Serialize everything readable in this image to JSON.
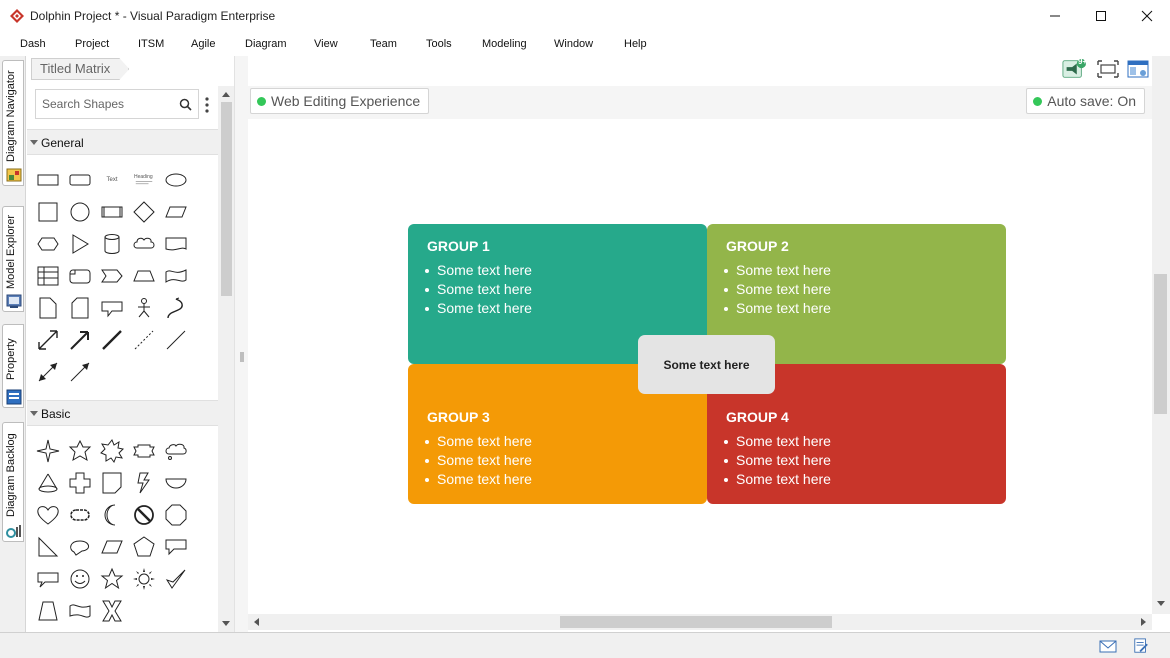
{
  "window": {
    "title": "Dolphin Project * - Visual Paradigm Enterprise",
    "logo_icon": "visual-paradigm-logo-icon",
    "controls": [
      "minimize-icon",
      "maximize-icon",
      "close-icon"
    ]
  },
  "menu": {
    "items": [
      "Dash",
      "Project",
      "ITSM",
      "Agile",
      "Diagram",
      "View",
      "Team",
      "Tools",
      "Modeling",
      "Window",
      "Help"
    ]
  },
  "side_tabs": [
    {
      "label": "Diagram Navigator",
      "icon": "diagram-navigator-icon"
    },
    {
      "label": "Model Explorer",
      "icon": "model-explorer-icon"
    },
    {
      "label": "Property",
      "icon": "property-icon"
    },
    {
      "label": "Diagram Backlog",
      "icon": "diagram-backlog-icon"
    }
  ],
  "palette": {
    "breadcrumb": "Titled Matrix",
    "search": {
      "placeholder": "Search Shapes",
      "value": ""
    },
    "sections": [
      {
        "label": "General",
        "expanded": true
      },
      {
        "label": "Basic",
        "expanded": true
      }
    ],
    "general_shape_text": {
      "text": "Text",
      "heading": "Heading"
    }
  },
  "toolbar_right": {
    "notification_badge": "9+",
    "icons": [
      "megaphone-notification-icon",
      "fit-diagram-icon",
      "layout-panel-icon"
    ]
  },
  "canvas": {
    "web_editing": "Web Editing Experience",
    "auto_save": "Auto save: On",
    "status_dot_color": "#34c759",
    "matrix": {
      "center_text": "Some text here",
      "groups": [
        {
          "title": "GROUP 1",
          "color": "#26a98b",
          "items": [
            "Some text here",
            "Some text here",
            "Some text here"
          ]
        },
        {
          "title": "GROUP 2",
          "color": "#93b54a",
          "items": [
            "Some text here",
            "Some text here",
            "Some text here"
          ]
        },
        {
          "title": "GROUP 3",
          "color": "#f49a06",
          "items": [
            "Some text here",
            "Some text here",
            "Some text here"
          ]
        },
        {
          "title": "GROUP 4",
          "color": "#c8352a",
          "items": [
            "Some text here",
            "Some text here",
            "Some text here"
          ]
        }
      ]
    }
  },
  "statusbar": {
    "icons": [
      "mail-icon",
      "edit-document-icon"
    ]
  }
}
